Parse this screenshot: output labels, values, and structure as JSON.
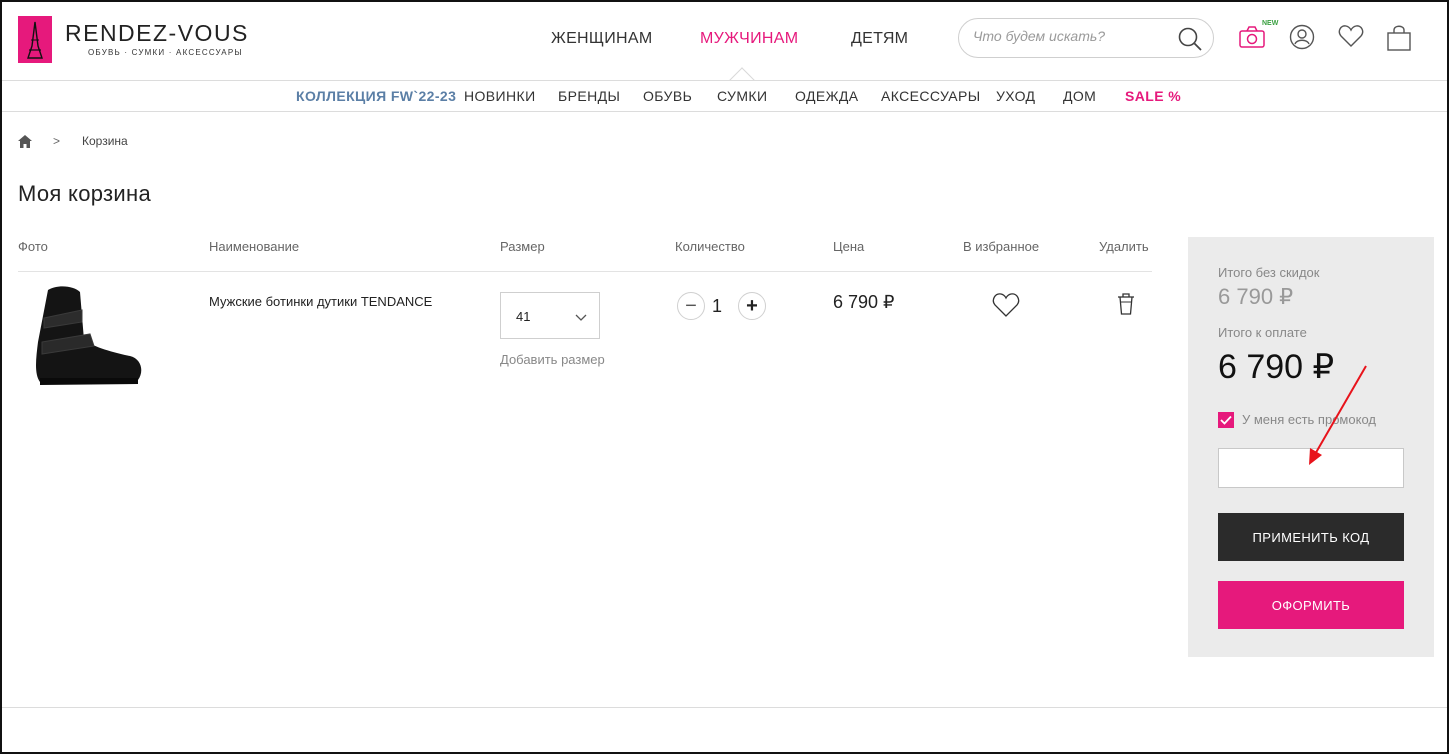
{
  "header": {
    "logo_title": "RENDEZ-VOUS",
    "logo_subtitle": "ОБУВЬ · СУМКИ · АКСЕССУАРЫ",
    "main_nav": [
      {
        "label": "ЖЕНЩИНАМ"
      },
      {
        "label": "МУЖЧИНАМ",
        "active": true
      },
      {
        "label": "ДЕТЯМ"
      }
    ],
    "search": {
      "placeholder": "Что будем искать?",
      "value": ""
    },
    "new_badge": "NEW",
    "icons": [
      "camera-icon",
      "account-icon",
      "heart-icon",
      "bag-icon"
    ]
  },
  "subnav": [
    {
      "label": "КОЛЛЕКЦИЯ FW`22-23"
    },
    {
      "label": "НОВИНКИ"
    },
    {
      "label": "БРЕНДЫ"
    },
    {
      "label": "ОБУВЬ"
    },
    {
      "label": "СУМКИ"
    },
    {
      "label": "ОДЕЖДА"
    },
    {
      "label": "АКСЕССУАРЫ"
    },
    {
      "label": "УХОД"
    },
    {
      "label": "ДОМ"
    },
    {
      "label": "SALE %"
    }
  ],
  "breadcrumb": {
    "separator": ">",
    "current": "Корзина"
  },
  "page_title": "Моя корзина",
  "cart": {
    "columns": [
      "Фото",
      "Наименование",
      "Размер",
      "Количество",
      "Цена",
      "В избранное",
      "Удалить"
    ],
    "items": [
      {
        "name": "Мужские ботинки дутики TENDANCE",
        "size": "41",
        "add_size": "Добавить размер",
        "quantity": "1",
        "minus": "−",
        "plus": "+",
        "price": "6 790 ₽"
      }
    ]
  },
  "summary": {
    "subtotal_label": "Итого без скидок",
    "subtotal": "6 790 ₽",
    "total_label": "Итого к оплате",
    "total": "6 790 ₽",
    "promo_label": "У меня есть промокод",
    "promo_checked": true,
    "promo_value": "",
    "apply_button": "ПРИМЕНИТЬ КОД",
    "checkout_button": "ОФОРМИТЬ"
  },
  "colors": {
    "brand": "#e6197c",
    "accent": "#5b7fa6",
    "dark_button": "#2b2b2b",
    "panel": "#ebebeb"
  }
}
